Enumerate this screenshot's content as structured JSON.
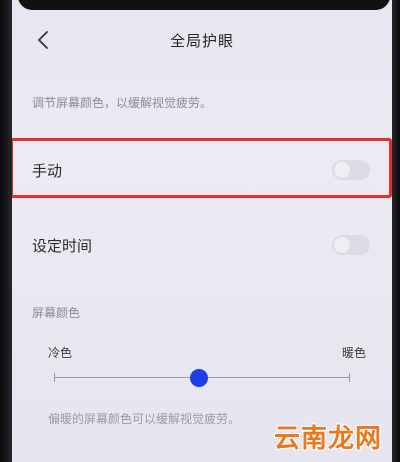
{
  "header": {
    "title": "全局护眼",
    "back_icon": "chevron-left-icon"
  },
  "description": "调节屏幕颜色，以缓解视觉疲劳。",
  "rows": [
    {
      "label": "手动",
      "toggle_on": false
    },
    {
      "label": "设定时间",
      "toggle_on": false
    }
  ],
  "screen_color": {
    "section_label": "屏幕颜色",
    "left_label": "冷色",
    "right_label": "暖色",
    "value": 0.49
  },
  "bottom_note": "偏暖的屏幕颜色可以缓解视觉疲劳。",
  "watermark": "云南龙网",
  "colors": {
    "accent": "#1f3ee8",
    "highlight": "#e23030",
    "watermark": "#e8791f"
  }
}
